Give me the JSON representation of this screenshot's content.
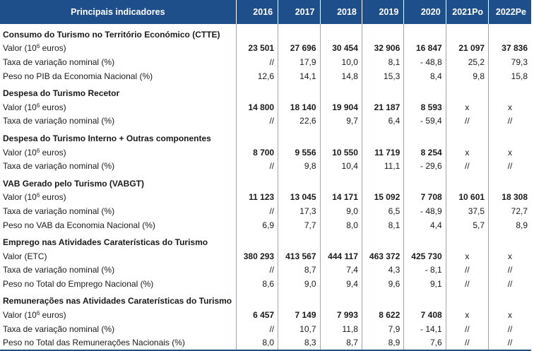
{
  "header": {
    "label": "Principais indicadores",
    "years": [
      "2016",
      "2017",
      "2018",
      "2019",
      "2020",
      "2021Po",
      "2022Pe"
    ]
  },
  "sections": [
    {
      "title": "Consumo do Turismo no Território Económico (CTTE)",
      "rows": [
        {
          "label_pre": "Valor (10",
          "label_sup": "6",
          "label_post": " euros)",
          "bold": true,
          "values": [
            "23 501",
            "27 696",
            "30 454",
            "32 906",
            "16 847",
            "21 097",
            "37 836"
          ]
        },
        {
          "label": "Taxa de variação nominal (%)",
          "values": [
            "//",
            "17,9",
            "10,0",
            "8,1",
            "-  48,8",
            "25,2",
            "79,3"
          ]
        },
        {
          "label": "Peso no PIB da Economia Nacional (%)",
          "values": [
            "12,6",
            "14,1",
            "14,8",
            "15,3",
            "8,4",
            "9,8",
            "15,8"
          ]
        }
      ]
    },
    {
      "title": "Despesa do Turismo Recetor",
      "rows": [
        {
          "label_pre": "Valor (10",
          "label_sup": "6",
          "label_post": " euros)",
          "bold": true,
          "values": [
            "14 800",
            "18 140",
            "19 904",
            "21 187",
            "8 593",
            "x",
            "x"
          ]
        },
        {
          "label": "Taxa de variação nominal (%)",
          "values": [
            "//",
            "22,6",
            "9,7",
            "6,4",
            "-  59,4",
            "//",
            "//"
          ]
        }
      ]
    },
    {
      "title": "Despesa do Turismo Interno + Outras componentes",
      "rows": [
        {
          "label_pre": "Valor (10",
          "label_sup": "6",
          "label_post": " euros)",
          "bold": true,
          "values": [
            "8 700",
            "9 556",
            "10 550",
            "11 719",
            "8 254",
            "x",
            "x"
          ]
        },
        {
          "label": "Taxa de variação nominal (%)",
          "values": [
            "//",
            "9,8",
            "10,4",
            "11,1",
            "-  29,6",
            "//",
            "//"
          ]
        }
      ]
    },
    {
      "title": "VAB Gerado pelo Turismo (VABGT)",
      "rows": [
        {
          "label_pre": "Valor (10",
          "label_sup": "6",
          "label_post": " euros)",
          "bold": true,
          "values": [
            "11 123",
            "13 045",
            "14 171",
            "15 092",
            "7 708",
            "10 601",
            "18 308"
          ]
        },
        {
          "label": "Taxa de variação nominal (%)",
          "values": [
            "//",
            "17,3",
            "9,0",
            "6,5",
            "-  48,9",
            "37,5",
            "72,7"
          ]
        },
        {
          "label": "Peso no VAB da Economia Nacional (%)",
          "values": [
            "6,9",
            "7,7",
            "8,0",
            "8,1",
            "4,4",
            "5,7",
            "8,9"
          ]
        }
      ]
    },
    {
      "title": "Emprego nas Atividades Caraterísticas do Turismo",
      "rows": [
        {
          "label": "Valor (ETC)",
          "bold": true,
          "values": [
            "380 293",
            "413 567",
            "444 117",
            "463 372",
            "425 730",
            "x",
            "x"
          ]
        },
        {
          "label": "Taxa de variação nominal (%)",
          "values": [
            "//",
            "8,7",
            "7,4",
            "4,3",
            "-  8,1",
            "//",
            "//"
          ]
        },
        {
          "label": "Peso no Total do Emprego Nacional (%)",
          "values": [
            "8,6",
            "9,0",
            "9,4",
            "9,6",
            "9,1",
            "//",
            "//"
          ]
        }
      ]
    },
    {
      "title": "Remunerações nas Atividades Caraterísticas do Turismo",
      "rows": [
        {
          "label_pre": "Valor (10",
          "label_sup": "6",
          "label_post": " euros)",
          "bold": true,
          "values": [
            "6 457",
            "7 149",
            "7 993",
            "8 622",
            "7 408",
            "x",
            "x"
          ]
        },
        {
          "label": "Taxa de variação nominal (%)",
          "values": [
            "//",
            "10,7",
            "11,8",
            "7,9",
            "-  14,1",
            "//",
            "//"
          ]
        },
        {
          "label": "Peso  no Total das Remunerações Nacionais (%)",
          "values": [
            "8,0",
            "8,3",
            "8,7",
            "8,9",
            "7,6",
            "//",
            "//"
          ]
        }
      ]
    }
  ]
}
